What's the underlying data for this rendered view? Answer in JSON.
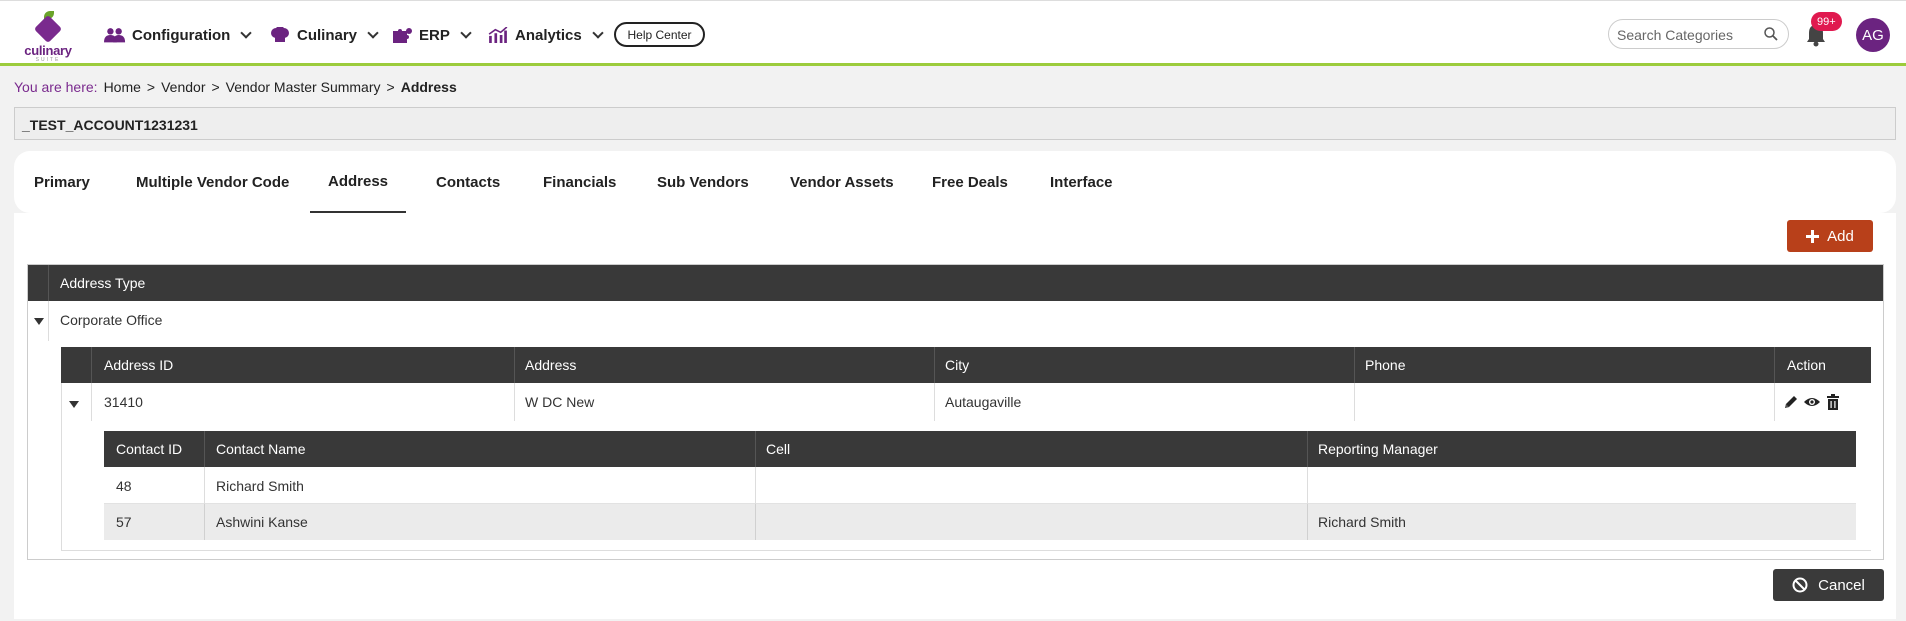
{
  "brand": {
    "name": "culinary",
    "sub": "SUITE"
  },
  "nav": {
    "items": [
      {
        "label": "Configuration",
        "icon": "users-icon"
      },
      {
        "label": "Culinary",
        "icon": "chef-hat-icon"
      },
      {
        "label": "ERP",
        "icon": "puzzle-icon"
      },
      {
        "label": "Analytics",
        "icon": "analytics-icon"
      }
    ],
    "help_label": "Help Center",
    "search_placeholder": "Search Categories",
    "notification_badge": "99+",
    "avatar_initials": "AG"
  },
  "breadcrumb": {
    "prefix": "You are here:",
    "items": [
      "Home",
      "Vendor",
      "Vendor Master Summary"
    ],
    "separator": ">",
    "current": "Address"
  },
  "account": "_TEST_ACCOUNT1231231",
  "tabs": [
    "Primary",
    "Multiple Vendor Code",
    "Address",
    "Contacts",
    "Financials",
    "Sub Vendors",
    "Vendor Assets",
    "Free Deals",
    "Interface"
  ],
  "active_tab": "Address",
  "buttons": {
    "add": "Add",
    "cancel": "Cancel"
  },
  "grid": {
    "group_header": "Address Type",
    "group_value": "Corporate Office",
    "address_columns": [
      "Address ID",
      "Address",
      "City",
      "Phone",
      "Action"
    ],
    "address_row": {
      "id": "31410",
      "address": "W DC New",
      "city": "Autaugaville",
      "phone": ""
    },
    "contact_columns": [
      "Contact ID",
      "Contact Name",
      "Cell",
      "Reporting Manager"
    ],
    "contacts": [
      {
        "id": "48",
        "name": "Richard Smith",
        "cell": "",
        "manager": ""
      },
      {
        "id": "57",
        "name": "Ashwini Kanse",
        "cell": "",
        "manager": "Richard Smith"
      }
    ]
  },
  "colors": {
    "brand_purple": "#6b2380",
    "accent_green": "#9ccc3c",
    "add_button": "#b8401a",
    "header_dark": "#393939",
    "badge_red": "#e0194f"
  }
}
